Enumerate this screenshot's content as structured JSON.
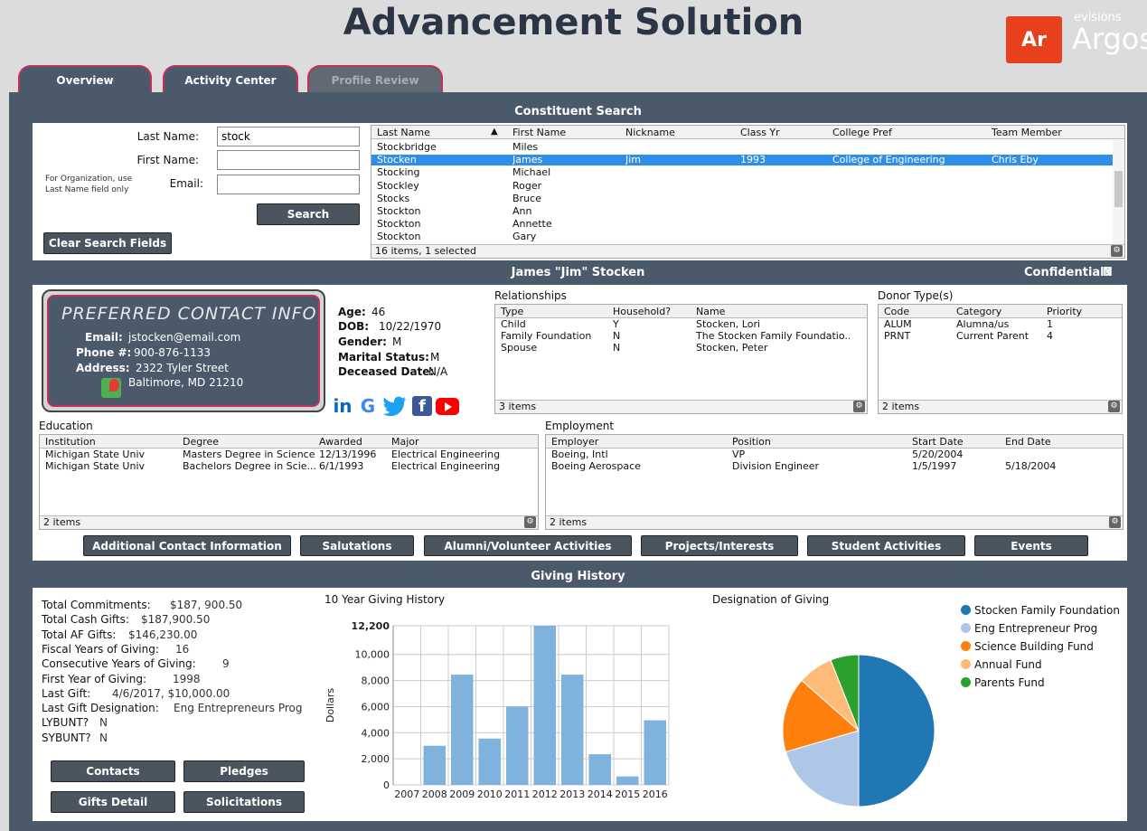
{
  "header": {
    "title": "Advancement Solution",
    "logo_badge": "Ar",
    "logo_small": "evisions",
    "logo_big": "Argos"
  },
  "tabs": [
    {
      "label": "Overview"
    },
    {
      "label": "Activity Center"
    },
    {
      "label": "Profile Review"
    }
  ],
  "search": {
    "section_title": "Constituent Search",
    "last_name_label": "Last Name:",
    "last_name_value": "stock",
    "first_name_label": "First Name:",
    "first_name_value": "",
    "email_label": "Email:",
    "email_value": "",
    "org_note": "For Organization, use Last Name field only",
    "search_button": "Search",
    "clear_button": "Clear Search Fields",
    "columns": [
      "Last Name",
      "First Name",
      "Nickname",
      "Class Yr",
      "College Pref",
      "Team Member"
    ],
    "rows": [
      [
        "Stockbridge",
        "Miles",
        "",
        "",
        "",
        ""
      ],
      [
        "Stocken",
        "James",
        "Jim",
        "1993",
        "College of Engineering",
        "Chris Eby"
      ],
      [
        "Stocking",
        "Michael",
        "",
        "",
        "",
        ""
      ],
      [
        "Stockley",
        "Roger",
        "",
        "",
        "",
        ""
      ],
      [
        "Stocks",
        "Bruce",
        "",
        "",
        "",
        ""
      ],
      [
        "Stockton",
        "Ann",
        "",
        "",
        "",
        ""
      ],
      [
        "Stockton",
        "Annette",
        "",
        "",
        "",
        ""
      ],
      [
        "Stockton",
        "Gary",
        "",
        "",
        "",
        ""
      ]
    ],
    "selected_row": 1,
    "footer": "16 items, 1 selected"
  },
  "profile": {
    "name_title": "James \"Jim\" Stocken",
    "confidential_label": "Confidential?",
    "confidential_value": "N",
    "contact_title": "PREFERRED CONTACT INFO",
    "email_label": "Email:",
    "email": "jstocken@email.com",
    "phone_label": "Phone #:",
    "phone": "900-876-1133",
    "address_label": "Address:",
    "address1": "2322 Tyler Street",
    "address2": "Baltimore, MD 21210",
    "age_label": "Age:",
    "age": "46",
    "dob_label": "DOB:",
    "dob": "10/22/1970",
    "gender_label": "Gender:",
    "gender": "M",
    "marital_label": "Marital Status:",
    "marital": "M",
    "deceased_label": "Deceased Date:",
    "deceased": "N/A"
  },
  "relationships": {
    "title": "Relationships",
    "columns": [
      "Type",
      "Household?",
      "Name"
    ],
    "rows": [
      [
        "Child",
        "Y",
        "Stocken, Lori"
      ],
      [
        "Family Foundation",
        "N",
        "The Stocken Family Foundatio..."
      ],
      [
        "Spouse",
        "N",
        "Stocken, Peter"
      ]
    ],
    "footer": "3 items"
  },
  "donor_types": {
    "title": "Donor Type(s)",
    "columns": [
      "Code",
      "Category",
      "Priority"
    ],
    "rows": [
      [
        "ALUM",
        "Alumna/us",
        "1"
      ],
      [
        "PRNT",
        "Current Parent",
        "4"
      ]
    ],
    "footer": "2 items"
  },
  "education": {
    "title": "Education",
    "columns": [
      "Institution",
      "Degree",
      "Awarded",
      "Major"
    ],
    "rows": [
      [
        "Michigan State Univ",
        "Masters Degree in Science",
        "12/13/1996",
        "Electrical Engineering"
      ],
      [
        "Michigan State Univ",
        "Bachelors Degree in Scie...",
        "6/1/1993",
        "Electrical Engineering"
      ]
    ],
    "footer": "2 items"
  },
  "employment": {
    "title": "Employment",
    "columns": [
      "Employer",
      "Position",
      "Start Date",
      "End Date"
    ],
    "rows": [
      [
        "Boeing, Intl",
        "VP",
        "5/20/2004",
        ""
      ],
      [
        "Boeing Aerospace",
        "Division Engineer",
        "1/5/1997",
        "5/18/2004"
      ]
    ],
    "footer": "2 items"
  },
  "action_buttons": [
    "Additional Contact Information",
    "Salutations",
    "Alumni/Volunteer Activities",
    "Projects/Interests",
    "Student Activities",
    "Events"
  ],
  "giving": {
    "section_title": "Giving History",
    "lines": [
      {
        "label": "Total Commitments:",
        "value": "$187, 900.50"
      },
      {
        "label": "Total Cash Gifts:",
        "value": "$187,900.50"
      },
      {
        "label": "Total AF Gifts:",
        "value": "$146,230.00"
      },
      {
        "label": "Fiscal Years of Giving:",
        "value": "16"
      },
      {
        "label": "Consecutive Years of Giving:",
        "value": "9"
      },
      {
        "label": "First Year of Giving:",
        "value": "1998"
      },
      {
        "label": "Last Gift:",
        "value": "4/6/2017, $10,000.00"
      },
      {
        "label": "Last Gift Designation:",
        "value": "Eng Entrepreneurs Prog"
      },
      {
        "label": "LYBUNT?",
        "value": "N"
      },
      {
        "label": "SYBUNT?",
        "value": "N"
      }
    ],
    "buttons": [
      "Contacts",
      "Pledges",
      "Gifts Detail",
      "Solicitations"
    ],
    "pie_title": "Designation of Giving"
  },
  "chart_data": [
    {
      "type": "bar",
      "title": "10 Year Giving History",
      "ylabel": "Dollars",
      "xlabel": "",
      "categories": [
        "2007",
        "2008",
        "2009",
        "2010",
        "2011",
        "2012",
        "2013",
        "2014",
        "2015",
        "2016"
      ],
      "values": [
        0,
        3000,
        8450,
        3550,
        6000,
        12200,
        8450,
        2350,
        650,
        4950
      ],
      "ylim": [
        0,
        12200
      ],
      "yticks": [
        0,
        2000,
        4000,
        6000,
        8000,
        10000,
        12200
      ],
      "ytick_labels": [
        "0",
        "2,000",
        "4,000",
        "6,000",
        "8,000",
        "10,000",
        "12,200"
      ],
      "grid": true,
      "color": "#7fb2dd"
    },
    {
      "type": "pie",
      "title": "Designation of Giving",
      "legend_position": "right",
      "slices": [
        {
          "name": "Stocken Family Foundation",
          "value": 50,
          "color": "#1f77b4"
        },
        {
          "name": "Eng Entrepreneur Prog",
          "value": 20.5,
          "color": "#aec7e8"
        },
        {
          "name": "Science Building Fund",
          "value": 16,
          "color": "#ff7f0e"
        },
        {
          "name": "Annual Fund",
          "value": 7.5,
          "color": "#ffbb78"
        },
        {
          "name": "Parents Fund",
          "value": 6,
          "color": "#2ca02c"
        }
      ]
    }
  ]
}
